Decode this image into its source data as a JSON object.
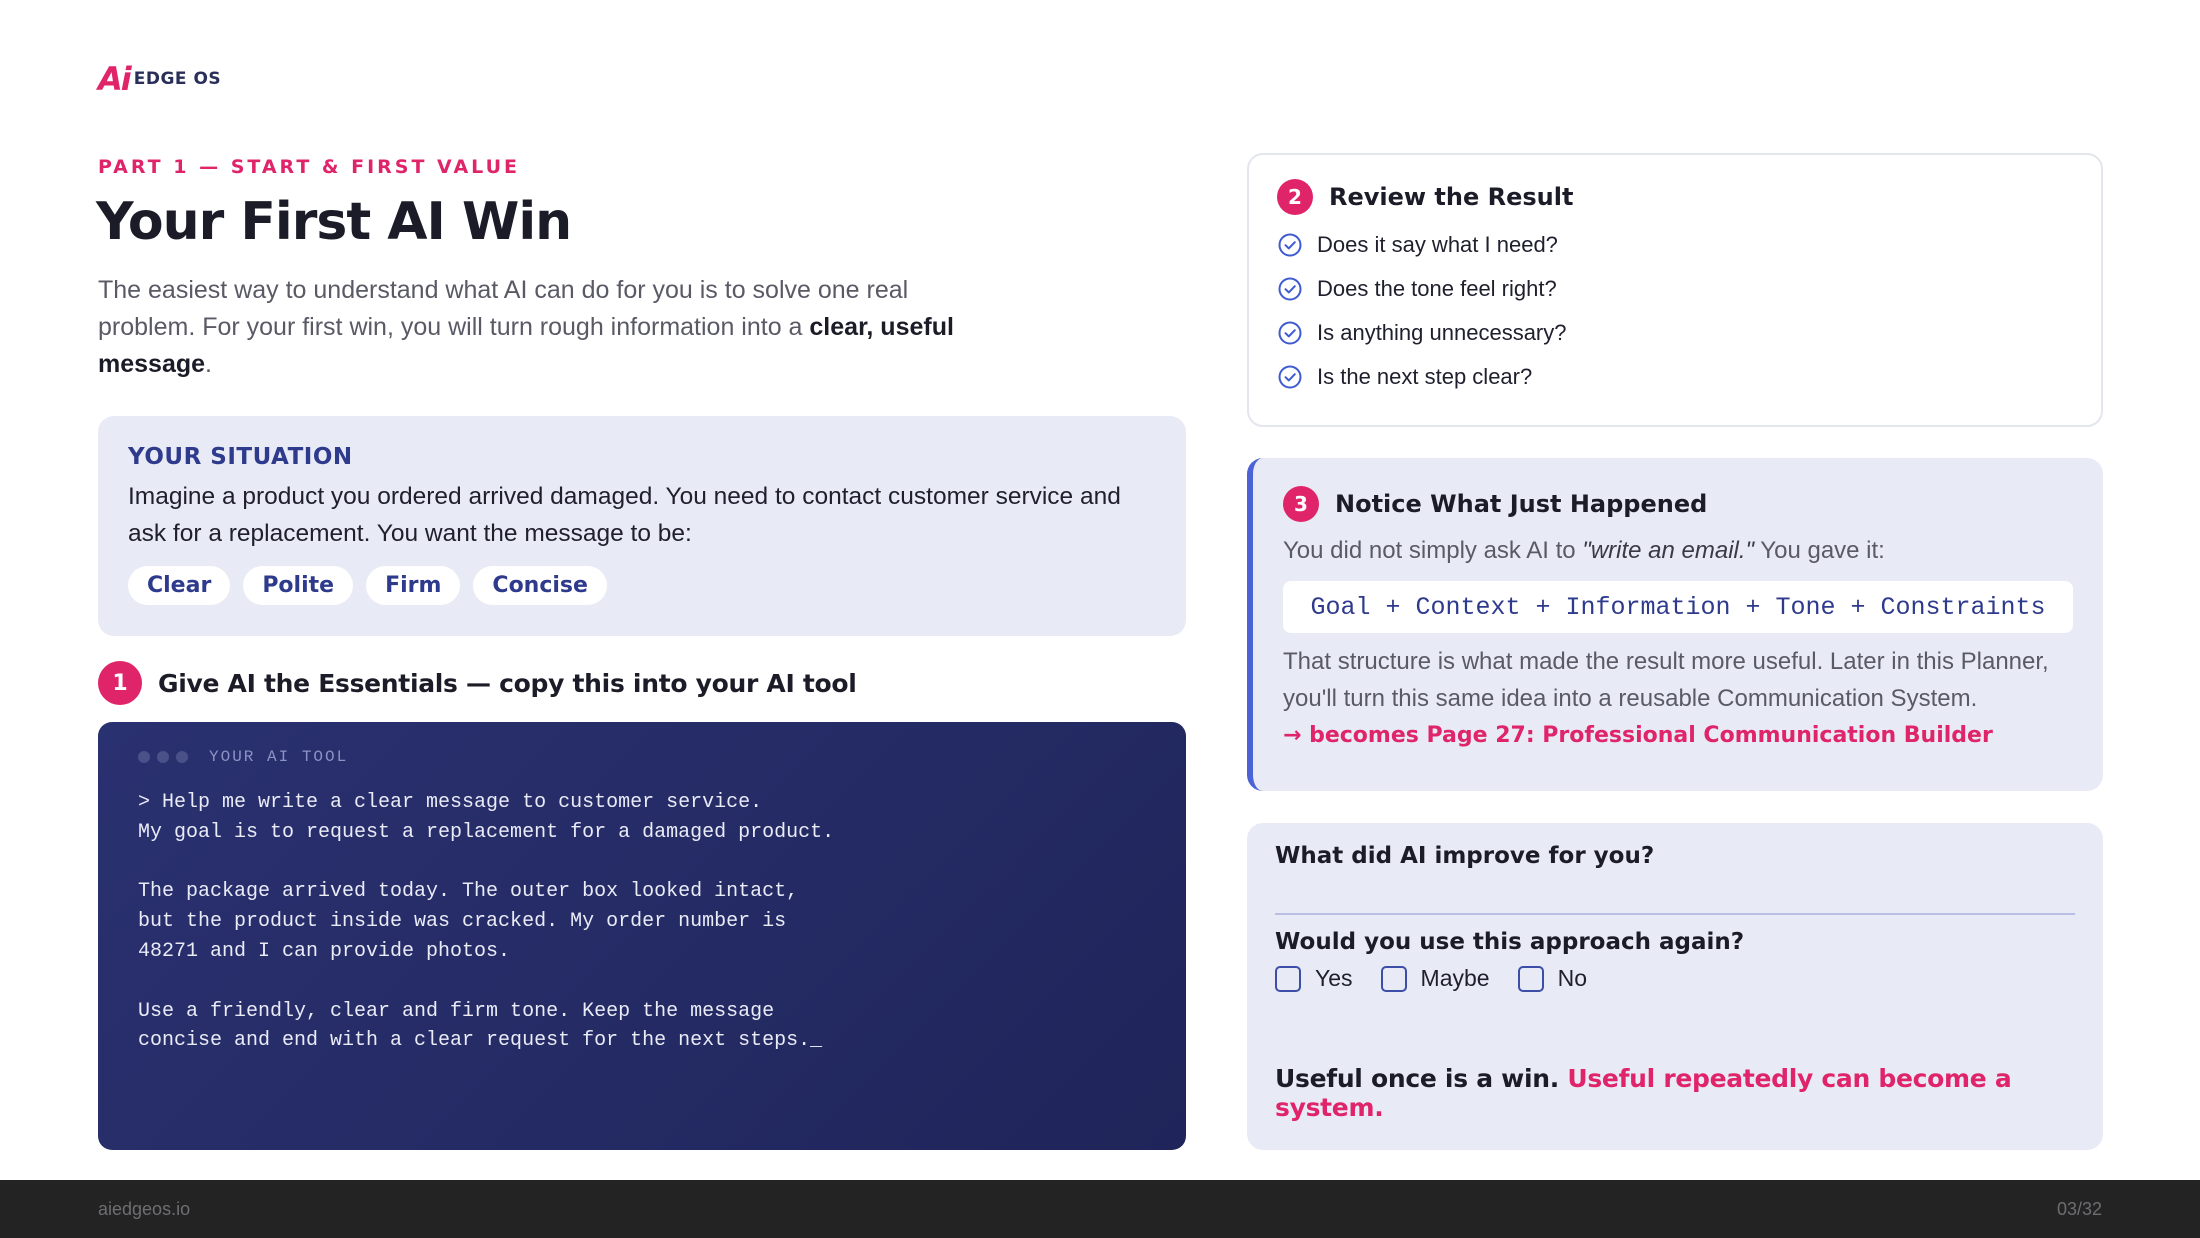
{
  "brand": {
    "mark": "Ai",
    "name": "EDGE OS",
    "accent": "#e0246a",
    "navy": "#2e3a8c"
  },
  "eyebrow": "PART 1 — START & FIRST VALUE",
  "title": "Your First AI Win",
  "intro": {
    "text": "The easiest way to understand what AI can do for you is to solve one real problem. For your first win, you will turn rough information into a ",
    "bold": "clear, useful message",
    "end": "."
  },
  "situation": {
    "heading": "YOUR SITUATION",
    "text": "Imagine a product you ordered arrived damaged. You need to contact customer service and ask for a replacement. You want the message to be:",
    "pills": [
      "Clear",
      "Polite",
      "Firm",
      "Concise"
    ]
  },
  "step1": {
    "number": "1",
    "title": "Give AI the Essentials — copy this into your AI tool"
  },
  "terminal": {
    "label": "YOUR AI TOOL",
    "code": "> Help me write a clear message to customer service.\nMy goal is to request a replacement for a damaged product.\n\nThe package arrived today. The outer box looked intact,\nbut the product inside was cracked. My order number is\n48271 and I can provide photos.\n\nUse a friendly, clear and firm tone. Keep the message\nconcise and end with a clear request for the next steps._"
  },
  "review": {
    "number": "2",
    "title": "Review the Result",
    "items": [
      "Does it say what I need?",
      "Does the tone feel right?",
      "Is anything unnecessary?",
      "Is the next step clear?"
    ]
  },
  "notice": {
    "number": "3",
    "title": "Notice What Just Happened",
    "lead": "You did not simply ask AI to ",
    "quote": "\"write an email.\"",
    "lead_end": " You gave it:",
    "formula": "Goal + Context + Information + Tone + Constraints",
    "body": "That structure is what made the result more useful. Later in this Planner, you'll turn this same idea into a reusable Communication System.",
    "becomes": "→ becomes Page 27: Professional Communication Builder"
  },
  "reflect": {
    "q1": "What did AI improve for you?",
    "q2": "Would you use this approach again?",
    "options": [
      "Yes",
      "Maybe",
      "No"
    ],
    "closing_plain": "Useful once is a win.",
    "closing_highlight": "Useful repeatedly can become a system."
  },
  "footer": {
    "site": "aiedgeos.io",
    "page": "03/32"
  }
}
